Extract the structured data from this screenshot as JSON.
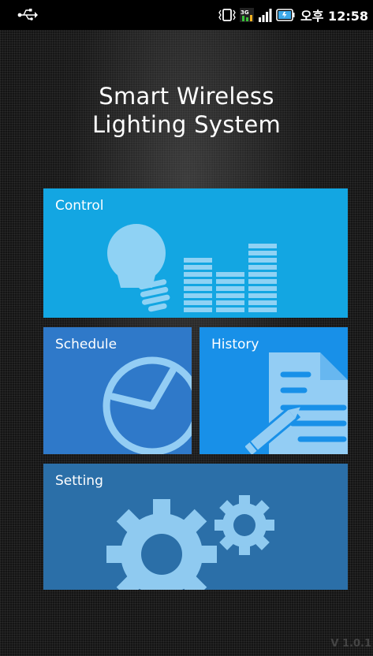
{
  "status_bar": {
    "time": "오후 12:58",
    "network": "3G"
  },
  "app": {
    "title_line1": "Smart Wireless",
    "title_line2": "Lighting System"
  },
  "tiles": [
    {
      "label": "Control",
      "icon": "lightbulb-equalizer-icon",
      "color": "#13a6e2"
    },
    {
      "label": "Schedule",
      "icon": "clock-icon",
      "color": "#2f79c9"
    },
    {
      "label": "History",
      "icon": "document-pencil-icon",
      "color": "#1890e8"
    },
    {
      "label": "Setting",
      "icon": "gears-icon",
      "color": "#2b6fa8"
    }
  ],
  "footer": {
    "version": "V 1.0.1"
  }
}
